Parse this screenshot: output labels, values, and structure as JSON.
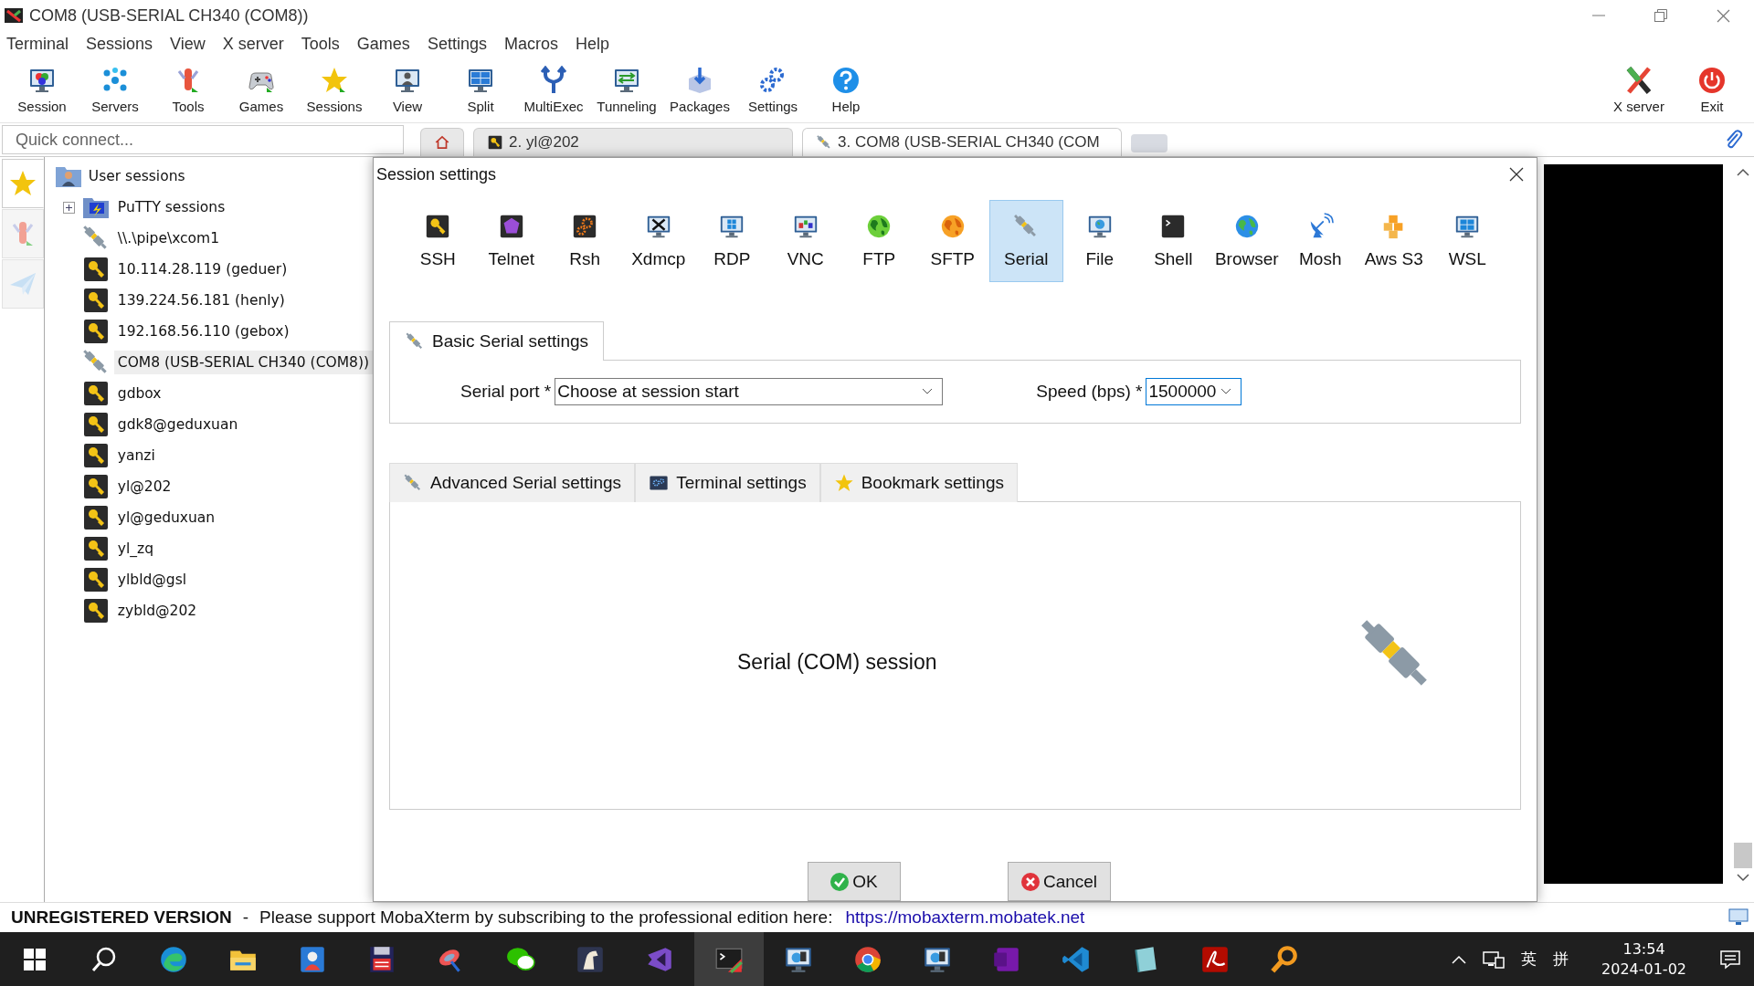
{
  "window": {
    "title": "COM8  (USB-SERIAL CH340 (COM8))"
  },
  "menu": [
    "Terminal",
    "Sessions",
    "View",
    "X server",
    "Tools",
    "Games",
    "Settings",
    "Macros",
    "Help"
  ],
  "toolbar": {
    "left": [
      {
        "kind": "session",
        "label": "Session"
      },
      {
        "kind": "servers",
        "label": "Servers"
      },
      {
        "kind": "tools",
        "label": "Tools"
      },
      {
        "kind": "games",
        "label": "Games"
      },
      {
        "kind": "sessions",
        "label": "Sessions"
      },
      {
        "kind": "view",
        "label": "View"
      },
      {
        "kind": "split",
        "label": "Split"
      },
      {
        "kind": "multiexec",
        "label": "MultiExec"
      },
      {
        "kind": "tunneling",
        "label": "Tunneling"
      },
      {
        "kind": "packages",
        "label": "Packages"
      },
      {
        "kind": "settings",
        "label": "Settings"
      },
      {
        "kind": "help",
        "label": "Help"
      }
    ],
    "right": [
      {
        "kind": "xserver",
        "label": "X server"
      },
      {
        "kind": "exit",
        "label": "Exit"
      }
    ]
  },
  "quick_connect": {
    "placeholder": "Quick connect..."
  },
  "session_tabs": [
    {
      "kind": "home",
      "selected": false
    },
    {
      "kind": "ssh",
      "label": "2. yl@202",
      "selected": false
    },
    {
      "kind": "serial",
      "label": "3. COM8  (USB-SERIAL CH340 (COM",
      "selected": true
    }
  ],
  "side_tabs": [
    {
      "kind": "star",
      "selected": true
    },
    {
      "kind": "tools",
      "selected": false
    },
    {
      "kind": "send",
      "selected": false
    }
  ],
  "session_tree": {
    "label": "User sessions",
    "children": [
      {
        "kind": "folder",
        "label": "PuTTY sessions",
        "expanded": false,
        "selected": false
      },
      {
        "kind": "serial",
        "label": "\\\\.\\pipe\\xcom1",
        "selected": false
      },
      {
        "kind": "ssh",
        "label": "10.114.28.119 (geduer)",
        "selected": false
      },
      {
        "kind": "ssh",
        "label": "139.224.56.181 (henly)",
        "selected": false
      },
      {
        "kind": "ssh",
        "label": "192.168.56.110 (gebox)",
        "selected": false
      },
      {
        "kind": "serial",
        "label": "COM8  (USB-SERIAL CH340 (COM8))",
        "selected": true
      },
      {
        "kind": "ssh",
        "label": "gdbox",
        "selected": false
      },
      {
        "kind": "ssh",
        "label": "gdk8@geduxuan",
        "selected": false
      },
      {
        "kind": "ssh",
        "label": "yanzi",
        "selected": false
      },
      {
        "kind": "ssh",
        "label": "yl@202",
        "selected": false
      },
      {
        "kind": "ssh",
        "label": "yl@geduxuan",
        "selected": false
      },
      {
        "kind": "ssh",
        "label": "yl_zq",
        "selected": false
      },
      {
        "kind": "ssh",
        "label": "ylbld@gsl",
        "selected": false
      },
      {
        "kind": "ssh",
        "label": "zybld@202",
        "selected": false
      }
    ]
  },
  "dialog": {
    "title": "Session settings",
    "protocols": [
      {
        "kind": "ssh",
        "label": "SSH",
        "selected": false
      },
      {
        "kind": "telnet",
        "label": "Telnet",
        "selected": false
      },
      {
        "kind": "rsh",
        "label": "Rsh",
        "selected": false
      },
      {
        "kind": "xdmcp",
        "label": "Xdmcp",
        "selected": false
      },
      {
        "kind": "rdp",
        "label": "RDP",
        "selected": false
      },
      {
        "kind": "vnc",
        "label": "VNC",
        "selected": false
      },
      {
        "kind": "ftp",
        "label": "FTP",
        "selected": false
      },
      {
        "kind": "sftp",
        "label": "SFTP",
        "selected": false
      },
      {
        "kind": "serial",
        "label": "Serial",
        "selected": true
      },
      {
        "kind": "file",
        "label": "File",
        "selected": false
      },
      {
        "kind": "shell",
        "label": "Shell",
        "selected": false
      },
      {
        "kind": "browser",
        "label": "Browser",
        "selected": false
      },
      {
        "kind": "mosh",
        "label": "Mosh",
        "selected": false
      },
      {
        "kind": "aws",
        "label": "Aws S3",
        "selected": false
      },
      {
        "kind": "wsl",
        "label": "WSL",
        "selected": false
      }
    ],
    "basic_tab": {
      "label": "Basic Serial settings",
      "selected": true
    },
    "fields": [
      {
        "label": "Serial port *",
        "value": "Choose at session start",
        "focused": false
      },
      {
        "label": "Speed (bps) *",
        "value": "1500000",
        "focused": true
      }
    ],
    "tabs": [
      {
        "kind": "serial",
        "label": "Advanced Serial settings",
        "selected": false
      },
      {
        "kind": "terminal",
        "label": "Terminal settings",
        "selected": false
      },
      {
        "kind": "bookmark",
        "label": "Bookmark settings",
        "selected": false
      }
    ],
    "description": "Serial (COM) session",
    "buttons": [
      {
        "kind": "ok",
        "label": "OK"
      },
      {
        "kind": "cancel",
        "label": "Cancel"
      }
    ]
  },
  "status_bar": {
    "title": "UNREGISTERED VERSION",
    "separator": "-",
    "message": "Please support MobaXterm by subscribing to the professional edition here:",
    "link": "https://mobaxterm.mobatek.net"
  },
  "taskbar": {
    "apps": [
      {
        "kind": "edge",
        "selected": false
      },
      {
        "kind": "folder",
        "selected": false
      },
      {
        "kind": "contacts",
        "selected": false
      },
      {
        "kind": "floppy",
        "selected": false
      },
      {
        "kind": "satellite",
        "selected": false
      },
      {
        "kind": "chat",
        "selected": false
      },
      {
        "kind": "horse",
        "selected": false
      },
      {
        "kind": "purple",
        "selected": false
      },
      {
        "kind": "terminal",
        "selected": true
      },
      {
        "kind": "monitor",
        "selected": false
      },
      {
        "kind": "chrome",
        "selected": false
      },
      {
        "kind": "monitor",
        "selected": false
      },
      {
        "kind": "note",
        "selected": false
      },
      {
        "kind": "code",
        "selected": false
      },
      {
        "kind": "notebook",
        "selected": false
      },
      {
        "kind": "pdf",
        "selected": false
      },
      {
        "kind": "magnifier",
        "selected": false
      }
    ],
    "tray": {
      "ime": "英",
      "layout": "拼",
      "time": "13:54",
      "date": "2024-01-02"
    }
  }
}
